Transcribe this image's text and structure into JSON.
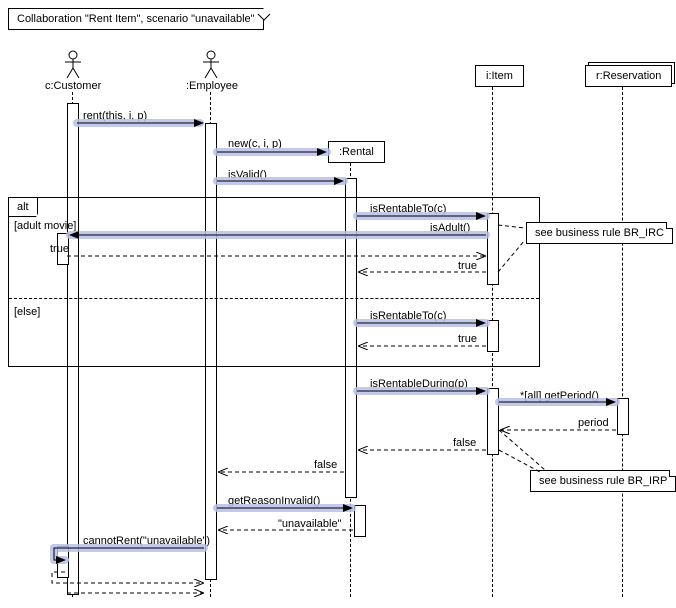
{
  "frame": {
    "header": "Collaboration \"Rent Item\", scenario \"unavailable\""
  },
  "lifelines": {
    "customer": {
      "label": "c:Customer"
    },
    "employee": {
      "label": ":Employee"
    },
    "rental": {
      "label": ":Rental"
    },
    "item": {
      "label": "i:Item"
    },
    "reservation": {
      "label": "r:Reservation"
    }
  },
  "messages": {
    "rent": "rent(this, i, p)",
    "new": "new(c, i, p)",
    "isValid": "isValid()",
    "isRentableTo1": "isRentableTo(c)",
    "isAdult": "isAdult()",
    "trueRet1": "true",
    "trueRet2": "true",
    "isRentableTo2": "isRentableTo(c)",
    "trueRet3": "true",
    "isRentableDuring": "isRentableDuring(p)",
    "getPeriod": "*[all] getPeriod()",
    "periodRet": "period",
    "falseRet1": "false",
    "falseRet2": "false",
    "getReasonInvalid": "getReasonInvalid()",
    "unavailableRet": "\"unavailable\"",
    "cannotRent": "cannotRent(\"unavailable\")"
  },
  "alt": {
    "label": "alt",
    "guard1": "[adult movie]",
    "guard2": "[else]"
  },
  "notes": {
    "br_irc": "see business rule BR_IRC",
    "br_irp": "see business rule BR_IRP"
  }
}
